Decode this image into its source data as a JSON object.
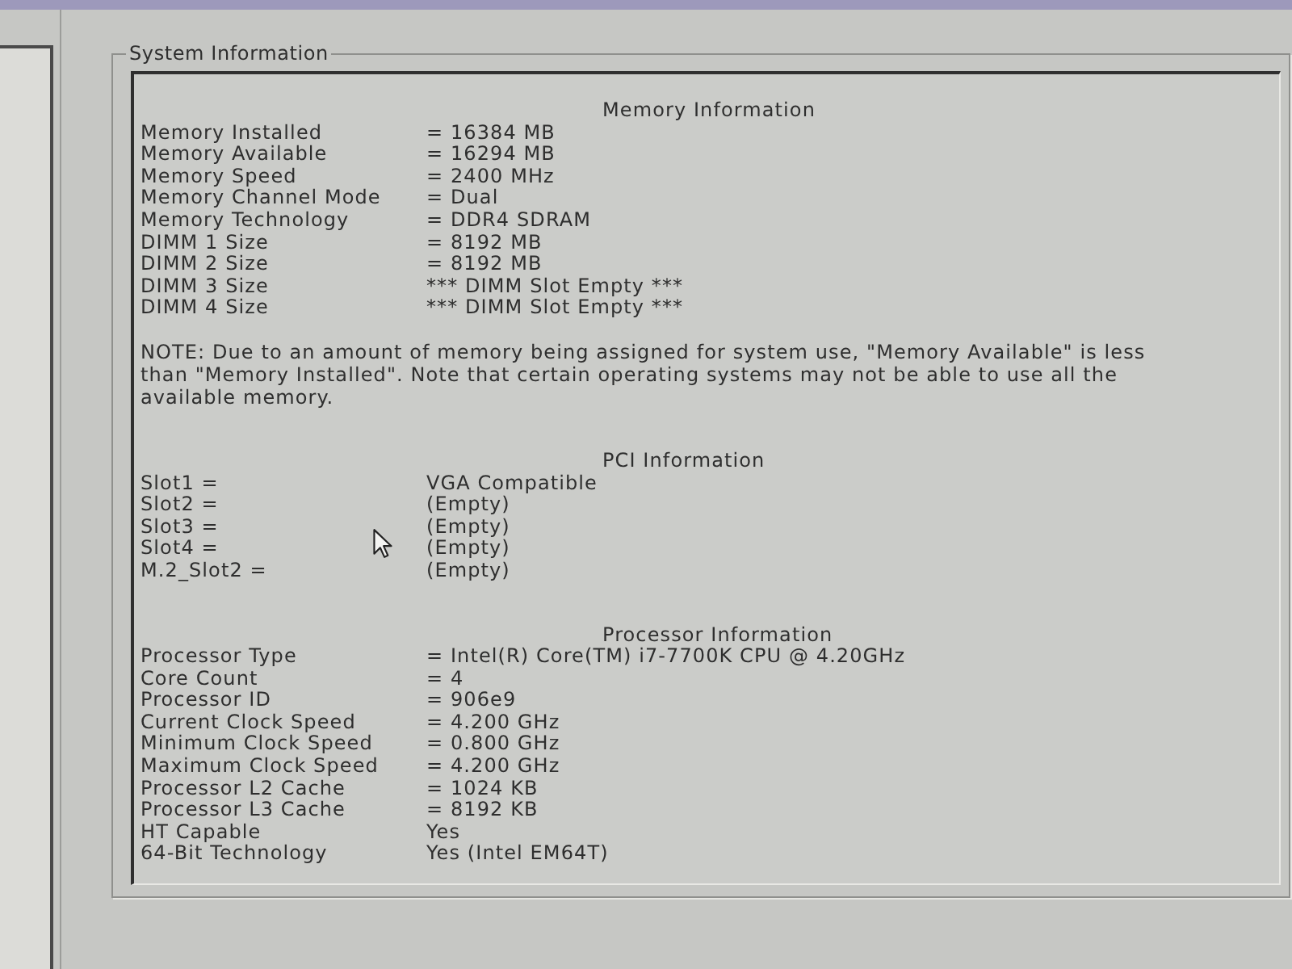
{
  "group_box": {
    "title": "System Information"
  },
  "sections": [
    {
      "heading": "Memory Information",
      "rows": [
        {
          "label": "Memory Installed",
          "value": "= 16384 MB"
        },
        {
          "label": "Memory Available",
          "value": "= 16294 MB"
        },
        {
          "label": "Memory Speed",
          "value": "= 2400 MHz"
        },
        {
          "label": "Memory Channel Mode",
          "value": "= Dual"
        },
        {
          "label": "Memory Technology",
          "value": "= DDR4 SDRAM"
        },
        {
          "label": "DIMM 1 Size",
          "value": "= 8192 MB"
        },
        {
          "label": "DIMM 2 Size",
          "value": "= 8192 MB"
        },
        {
          "label": "DIMM 3 Size",
          "value": "*** DIMM Slot Empty ***"
        },
        {
          "label": "DIMM 4 Size",
          "value": "*** DIMM Slot Empty ***"
        }
      ],
      "note": "NOTE: Due to an amount of memory being assigned for system use, \"Memory Available\" is less than \"Memory Installed\". Note that certain operating systems may not be able to use all the available memory."
    },
    {
      "heading": "PCI Information",
      "rows": [
        {
          "label": "Slot1 =",
          "value": "VGA Compatible"
        },
        {
          "label": "Slot2 =",
          "value": "(Empty)"
        },
        {
          "label": "Slot3 =",
          "value": "(Empty)"
        },
        {
          "label": "Slot4 =",
          "value": "(Empty)"
        },
        {
          "label": "M.2_Slot2 =",
          "value": "(Empty)"
        }
      ]
    },
    {
      "heading": "Processor Information",
      "rows": [
        {
          "label": "Processor Type",
          "value": "= Intel(R) Core(TM) i7-7700K CPU @ 4.20GHz"
        },
        {
          "label": "Core Count",
          "value": "= 4"
        },
        {
          "label": "Processor ID",
          "value": "= 906e9"
        },
        {
          "label": "Current Clock Speed",
          "value": "= 4.200 GHz"
        },
        {
          "label": "Minimum Clock Speed",
          "value": "= 0.800 GHz"
        },
        {
          "label": "Maximum Clock Speed",
          "value": "= 4.200 GHz"
        },
        {
          "label": "Processor L2 Cache",
          "value": "= 1024 KB"
        },
        {
          "label": "Processor L3 Cache",
          "value": "= 8192 KB"
        },
        {
          "label": "HT Capable",
          "value": "Yes"
        },
        {
          "label": "64-Bit Technology",
          "value": "Yes (Intel EM64T)"
        }
      ]
    }
  ]
}
